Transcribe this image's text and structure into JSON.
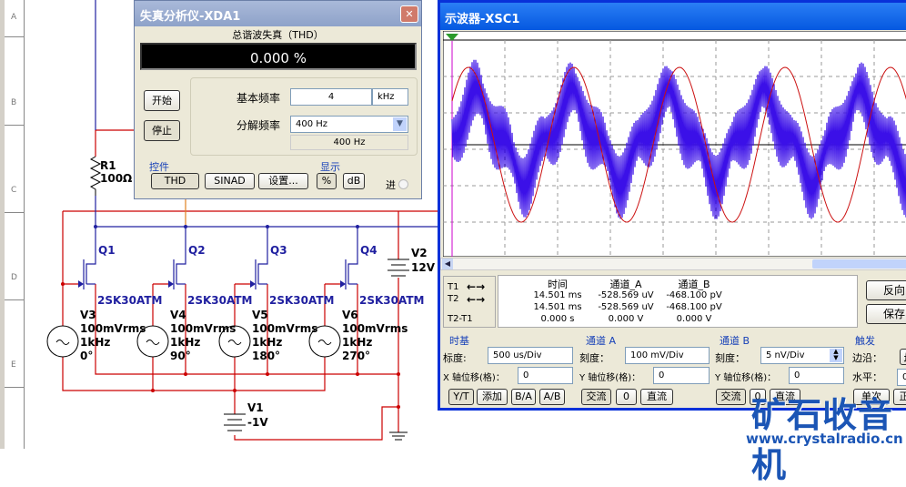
{
  "ruler": {
    "rows": [
      "A",
      "B",
      "C",
      "D",
      "E"
    ]
  },
  "schematic": {
    "r1": {
      "name": "R1",
      "value": "100Ω"
    },
    "transistors": [
      {
        "name": "Q1",
        "model": "2SK30ATM"
      },
      {
        "name": "Q2",
        "model": "2SK30ATM"
      },
      {
        "name": "Q3",
        "model": "2SK30ATM"
      },
      {
        "name": "Q4",
        "model": "2SK30ATM"
      }
    ],
    "sources": [
      {
        "name": "V3",
        "amp": "100mVrms",
        "freq": "1kHz",
        "phase": "0°"
      },
      {
        "name": "V4",
        "amp": "100mVrms",
        "freq": "1kHz",
        "phase": "90°"
      },
      {
        "name": "V5",
        "amp": "100mVrms",
        "freq": "1kHz",
        "phase": "180°"
      },
      {
        "name": "V6",
        "amp": "100mVrms",
        "freq": "1kHz",
        "phase": "270°"
      }
    ],
    "v2": {
      "name": "V2",
      "value": "12V"
    },
    "v1": {
      "name": "V1",
      "value": "-1V"
    }
  },
  "analyzer": {
    "title": "失真分析仪-XDA1",
    "thd_heading": "总谐波失真（THD）",
    "reading": "0.000 %",
    "start": "开始",
    "stop": "停止",
    "fund_label": "基本频率",
    "fund_value": "4",
    "fund_unit": "kHz",
    "res_label": "分解频率",
    "res_value": "400 Hz",
    "res_readout": "400 Hz",
    "controls_label": "控件",
    "thd": "THD",
    "sinad": "SINAD",
    "settings": "设置...",
    "display_label": "显示",
    "pct": "%",
    "db": "dB",
    "in_label": "进"
  },
  "scope": {
    "title": "示波器-XSC1",
    "colors": {
      "a": "#cc1111",
      "b": "#3b10e8"
    },
    "readout": {
      "t1": "T1",
      "t2": "T2",
      "t21": "T2-T1",
      "headers": [
        "时间",
        "通道_A",
        "通道_B"
      ],
      "rows": [
        [
          "14.501 ms",
          "-528.569 uV",
          "-468.100 pV"
        ],
        [
          "14.501 ms",
          "-528.569 uV",
          "-468.100 pV"
        ],
        [
          "0.000 s",
          "0.000 V",
          "0.000 V"
        ]
      ],
      "reverse": "反向",
      "save": "保存"
    },
    "timebase": {
      "label": "时基",
      "scale_label": "标度:",
      "scale": "500 us/Div",
      "xpos_label": "X 轴位移(格)：",
      "xpos": "0",
      "yt": "Y/T",
      "add": "添加",
      "ba": "B/A",
      "ab": "A/B"
    },
    "chA": {
      "label": "通道 A",
      "scale_label": "刻度：",
      "scale": "100 mV/Div",
      "ypos_label": "Y 轴位移(格)：",
      "ypos": "0",
      "ac": "交流",
      "zero": "0",
      "dc": "直流"
    },
    "chB": {
      "label": "通道 B",
      "scale_label": "刻度：",
      "scale": "5 nV/Div",
      "ypos_label": "Y 轴位移(格)：",
      "ypos": "0",
      "ac": "交流",
      "zero": "0",
      "dc": "直流"
    },
    "trigger": {
      "label": "触发",
      "edge_label": "边沿：",
      "level_label": "水平：",
      "level": "0",
      "single": "单次",
      "normal": "正"
    }
  },
  "watermark": {
    "title": "矿石收音机",
    "url": "www.crystalradio.cn"
  }
}
